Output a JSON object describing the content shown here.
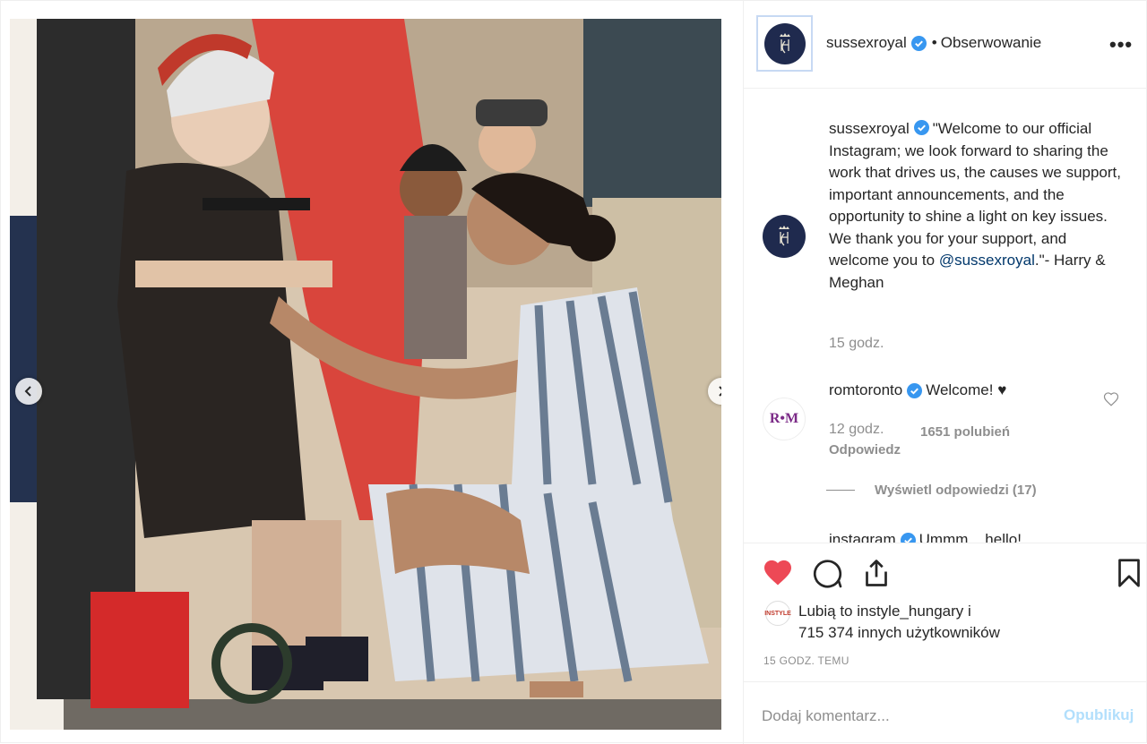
{
  "post": {
    "username": "sussexroyal",
    "separator": "•",
    "follow_label": "Obserwowanie",
    "more_label": "•••"
  },
  "caption": {
    "username": "sussexroyal",
    "text_before": "\"Welcome to our official Instagram; we look forward to sharing the work that drives us, the causes we support, important announcements, and the opportunity to shine a light on key issues. We thank you for your support, and welcome you to ",
    "mention": "@sussexroyal",
    "text_after": ".\"- Harry & Meghan",
    "time": "15 godz."
  },
  "comments": [
    {
      "username": "romtoronto",
      "avatar_text": "R•M",
      "text": "Welcome! ♥",
      "time": "12 godz.",
      "likes": "1651 polubień",
      "reply_label": "Odpowiedz",
      "view_replies": "Wyświetl odpowiedzi (17)"
    },
    {
      "username": "instagram",
      "text": "Ummm... hello!"
    }
  ],
  "actions": {
    "liked": true,
    "heart_color": "#ed4956"
  },
  "likes": {
    "avatar_text": "INSTYLE",
    "line1": "Lubią to instyle_hungary i",
    "line2": "715 374 innych użytkowników"
  },
  "posted_time": "15 GODZ. TEMU",
  "add_comment": {
    "placeholder": "Dodaj komentarz...",
    "post_label": "Opublikuj"
  },
  "carousel": {
    "slide_count": 10,
    "active_index": 6
  },
  "colors": {
    "verified": "#3897f0",
    "link": "#00376b",
    "muted": "#8e8e8e"
  }
}
